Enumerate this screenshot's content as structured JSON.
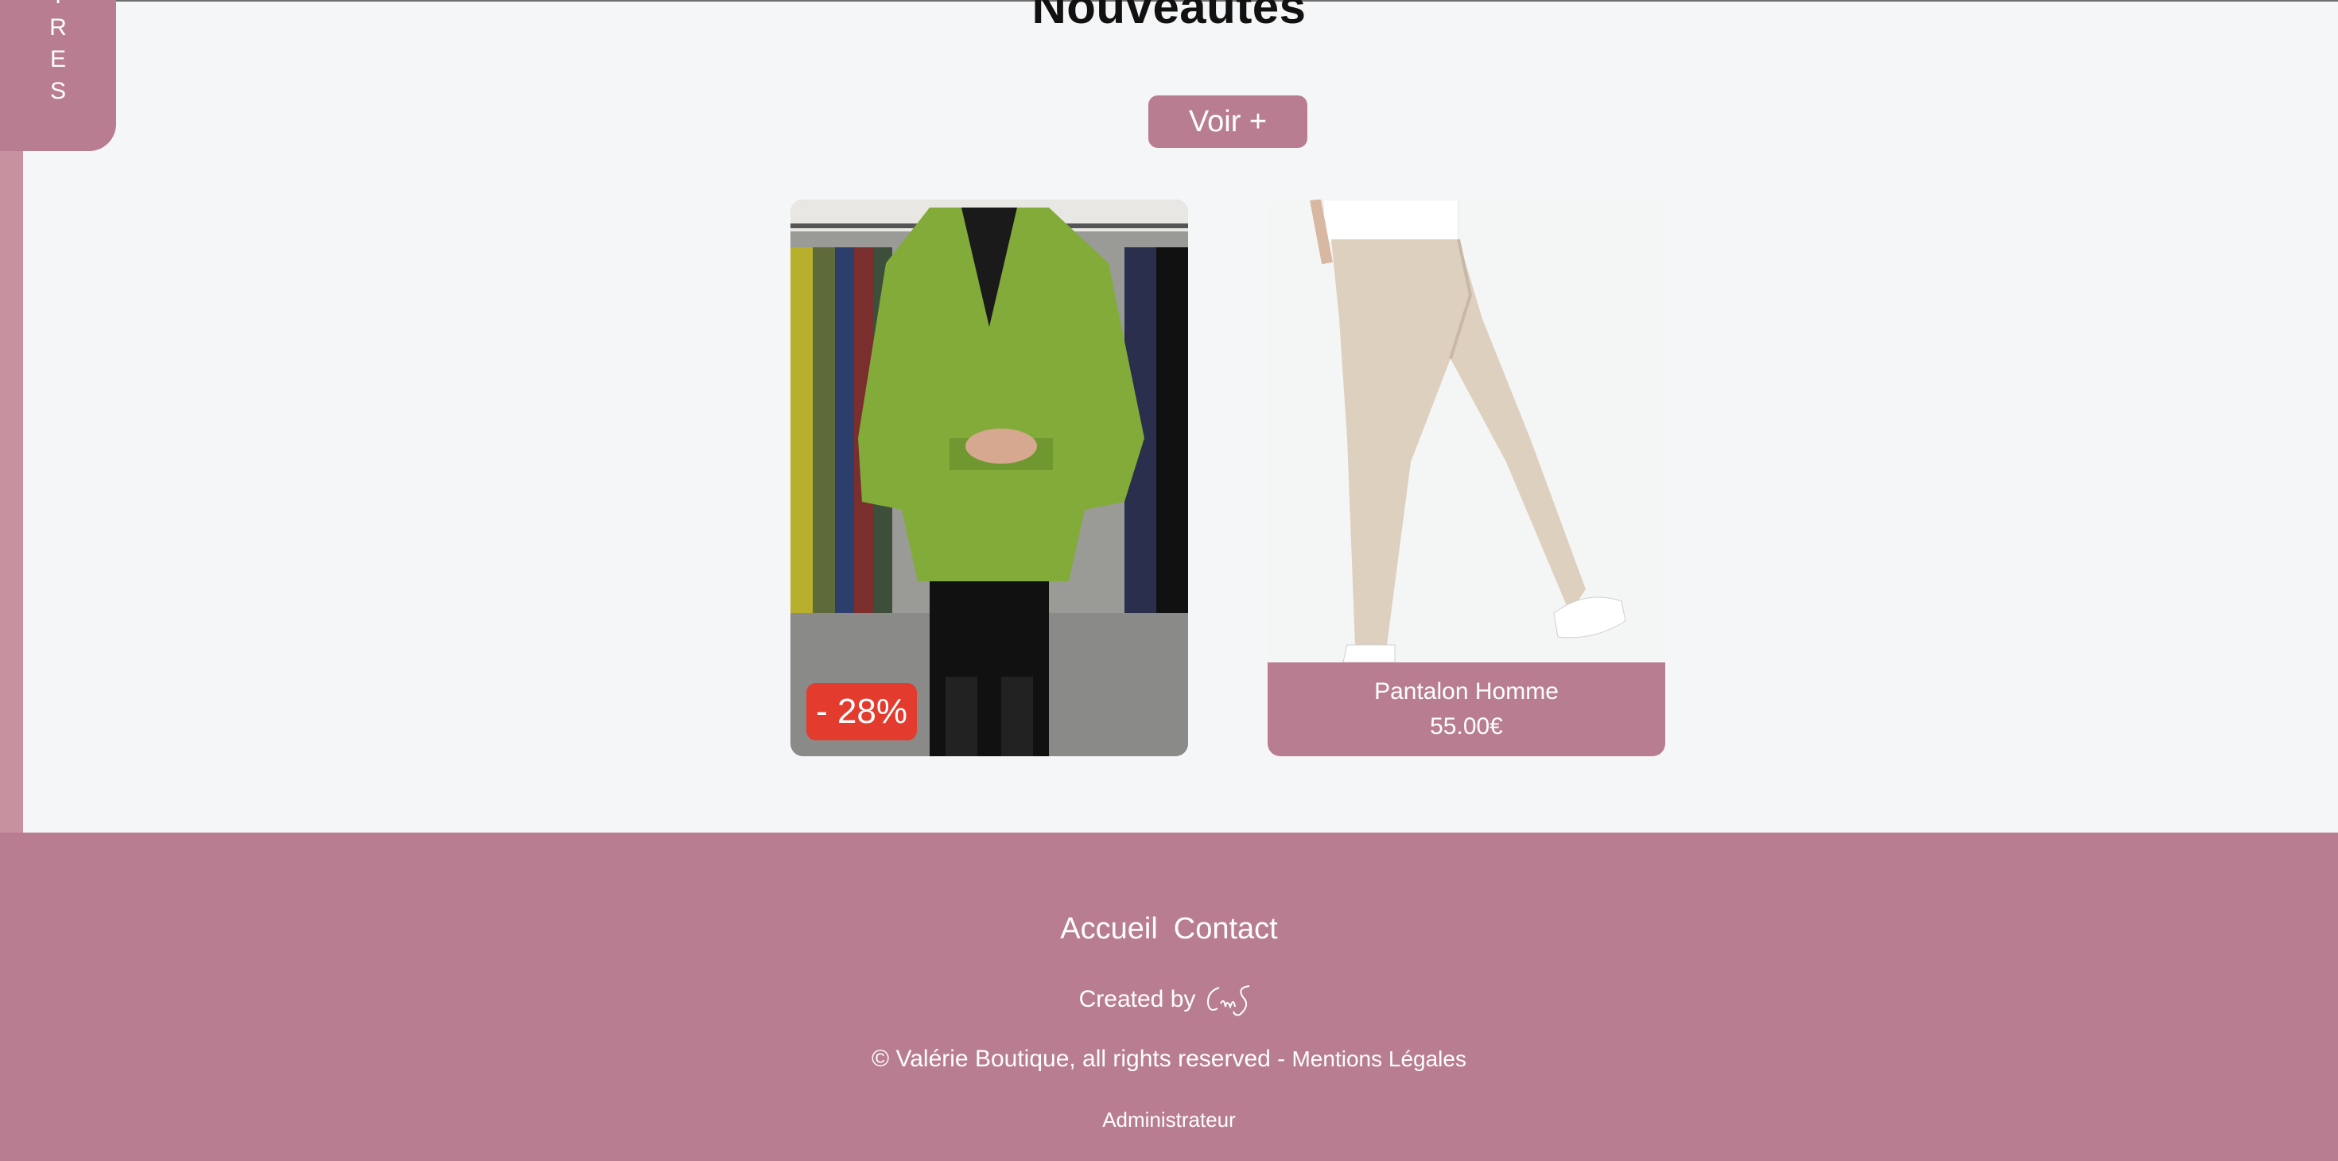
{
  "sidebar": {
    "tab_letters": [
      "I",
      "R",
      "E",
      "S"
    ]
  },
  "section": {
    "title": "Nouveautés",
    "see_more_label": "Voir +"
  },
  "products": [
    {
      "badge": "- 28%"
    },
    {
      "name": "Pantalon Homme",
      "price": "55.00€"
    }
  ],
  "footer": {
    "nav": [
      "Accueil",
      "Contact"
    ],
    "created_by": "Created by",
    "signature": "CmS",
    "copyright": "© Valérie Boutique, all rights reserved -",
    "legal_link": "Mentions Légales",
    "admin_link": "Administrateur"
  },
  "colors": {
    "brand": "#b97d91",
    "badge": "#e33b2e",
    "background": "#f5f6f8"
  }
}
